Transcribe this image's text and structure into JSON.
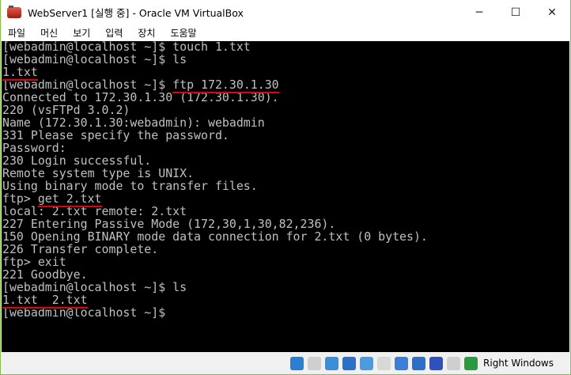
{
  "window": {
    "title": "WebServer1 [실행 중] - Oracle VM VirtualBox",
    "minimize": "─",
    "maximize": "☐",
    "close": "✕"
  },
  "menu": [
    "파일",
    "머신",
    "보기",
    "입력",
    "장치",
    "도움말"
  ],
  "terminal": {
    "lines": [
      {
        "pre": "[webadmin@localhost ~]$ touch 1.txt",
        "ul": ""
      },
      {
        "pre": "[webadmin@localhost ~]$ ls",
        "ul": ""
      },
      {
        "pre": "",
        "ul": "1.txt"
      },
      {
        "pre": "[webadmin@localhost ~]$ ",
        "ul": "ftp 172.30.1.30"
      },
      {
        "pre": "Connected to 172.30.1.30 (172.30.1.30).",
        "ul": ""
      },
      {
        "pre": "220 (vsFTPd 3.0.2)",
        "ul": ""
      },
      {
        "pre": "Name (172.30.1.30:webadmin): webadmin",
        "ul": ""
      },
      {
        "pre": "331 Please specify the password.",
        "ul": ""
      },
      {
        "pre": "Password:",
        "ul": ""
      },
      {
        "pre": "230 Login successful.",
        "ul": ""
      },
      {
        "pre": "Remote system type is UNIX.",
        "ul": ""
      },
      {
        "pre": "Using binary mode to transfer files.",
        "ul": ""
      },
      {
        "pre": "ftp> ",
        "ul": "get 2.txt"
      },
      {
        "pre": "local: 2.txt remote: 2.txt",
        "ul": ""
      },
      {
        "pre": "227 Entering Passive Mode (172,30,1,30,82,236).",
        "ul": ""
      },
      {
        "pre": "150 Opening BINARY mode data connection for 2.txt (0 bytes).",
        "ul": ""
      },
      {
        "pre": "226 Transfer complete.",
        "ul": ""
      },
      {
        "pre": "ftp> exit",
        "ul": ""
      },
      {
        "pre": "221 Goodbye.",
        "ul": ""
      },
      {
        "pre": "[webadmin@localhost ~]$ ls",
        "ul": ""
      },
      {
        "pre": "",
        "ul": "1.txt  2.txt"
      },
      {
        "pre": "[webadmin@localhost ~]$",
        "ul": ""
      }
    ]
  },
  "status": {
    "icons": [
      {
        "name": "hard-disk-icon",
        "color": "#2a7fd0"
      },
      {
        "name": "optical-drive-icon",
        "color": "#cfcfcf"
      },
      {
        "name": "audio-icon",
        "color": "#3a8fd8"
      },
      {
        "name": "network-icon",
        "color": "#2a6fc8"
      },
      {
        "name": "usb-icon",
        "color": "#4a9be0"
      },
      {
        "name": "shared-folder-icon",
        "color": "#d8d8d8"
      },
      {
        "name": "display-icon",
        "color": "#3a80d8"
      },
      {
        "name": "video-capture-icon",
        "color": "#2a6fc8"
      },
      {
        "name": "cpu-icon",
        "color": "#3050c0"
      },
      {
        "name": "mouse-integration-icon",
        "color": "#cfcfcf"
      },
      {
        "name": "keyboard-capture-icon",
        "color": "#2a9a40"
      }
    ],
    "host_key": "Right Windows"
  }
}
